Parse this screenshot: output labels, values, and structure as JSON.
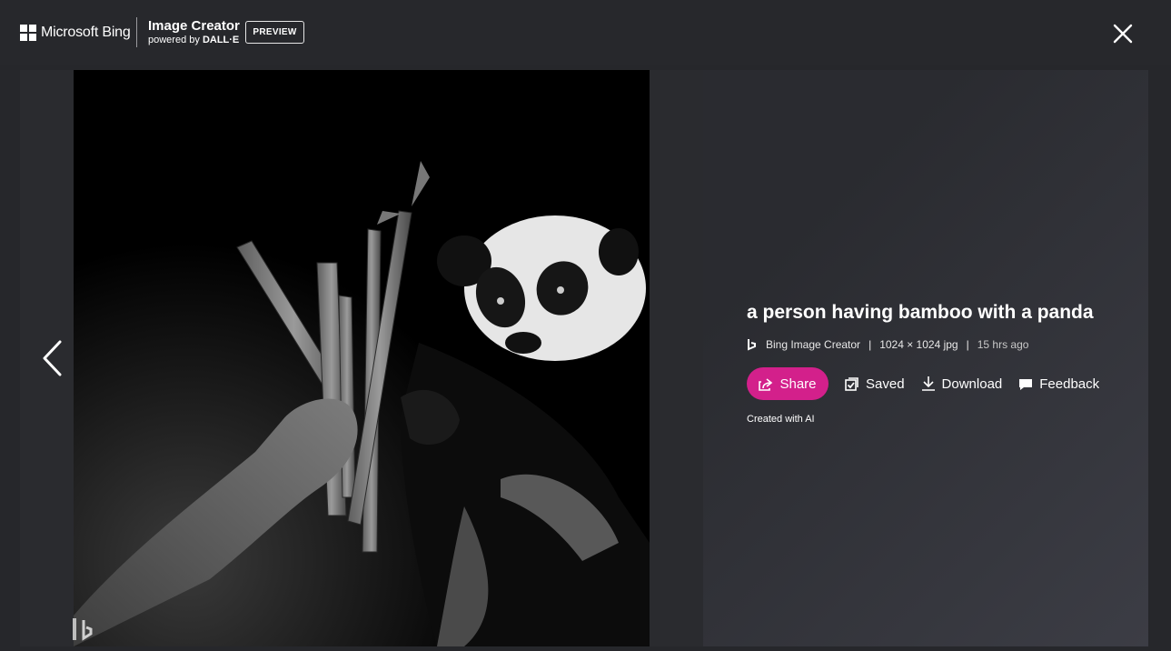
{
  "header": {
    "brand": "Microsoft Bing",
    "product_title": "Image Creator",
    "product_sub_prefix": "powered by",
    "product_sub_model": "DALL·E",
    "preview_label": "PREVIEW",
    "close_icon": "close-icon"
  },
  "image": {
    "alt": "Black and white picture of a hand offering bamboo stalks to a panda",
    "watermark_icon": "bing-logo-icon",
    "prev_icon": "chevron-left-icon"
  },
  "details": {
    "title": "a person having bamboo with a panda",
    "source": "Bing Image Creator",
    "separator": "|",
    "dimensions": "1024 × 1024 jpg",
    "age": "15 hrs ago",
    "created_note": "Created with AI"
  },
  "actions": {
    "share": "Share",
    "saved": "Saved",
    "download": "Download",
    "feedback": "Feedback"
  },
  "colors": {
    "share_accent": "#d3208b",
    "background": "#26272b"
  }
}
